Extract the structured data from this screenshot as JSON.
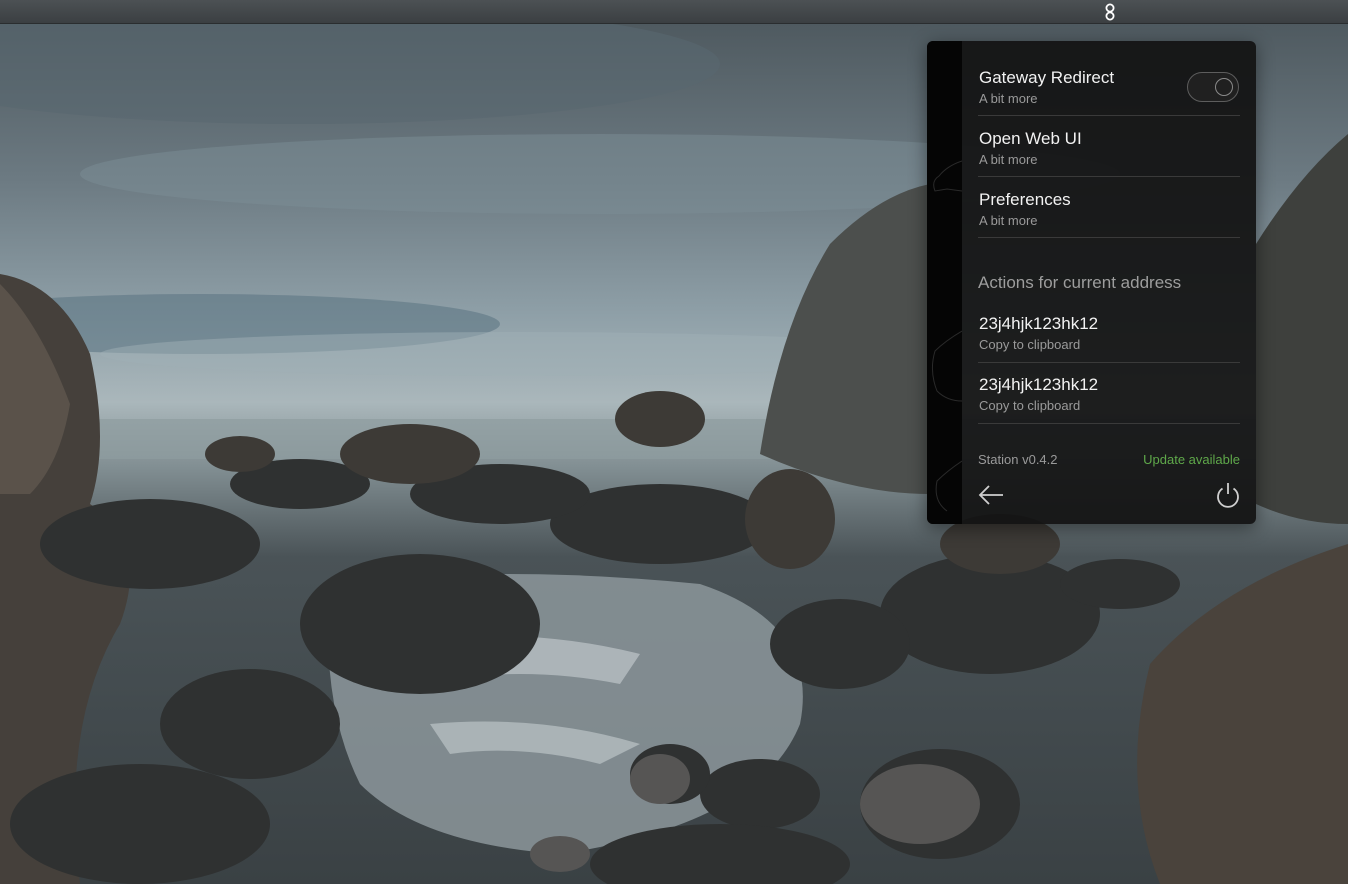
{
  "menubar": {
    "icon": "station-tray-icon"
  },
  "desktop": {
    "wallpaper": "rocky-shore-wallpaper"
  },
  "popup": {
    "items": [
      {
        "title": "Gateway Redirect",
        "subtitle": "A bit more",
        "toggle": false
      },
      {
        "title": "Open Web UI",
        "subtitle": "A bit more"
      },
      {
        "title": "Preferences",
        "subtitle": "A bit more"
      }
    ],
    "section_heading": "Actions for current address",
    "addresses": [
      {
        "title": "23j4hjk123hk12",
        "subtitle": "Copy to clipboard"
      },
      {
        "title": "23j4hjk123hk12",
        "subtitle": "Copy to clipboard"
      }
    ],
    "version": "Station v0.4.2",
    "update": "Update available",
    "colors": {
      "accent": "#5fa84a",
      "background": "#121212"
    },
    "icons": {
      "back": "arrow-left-icon",
      "power": "power-icon"
    }
  }
}
